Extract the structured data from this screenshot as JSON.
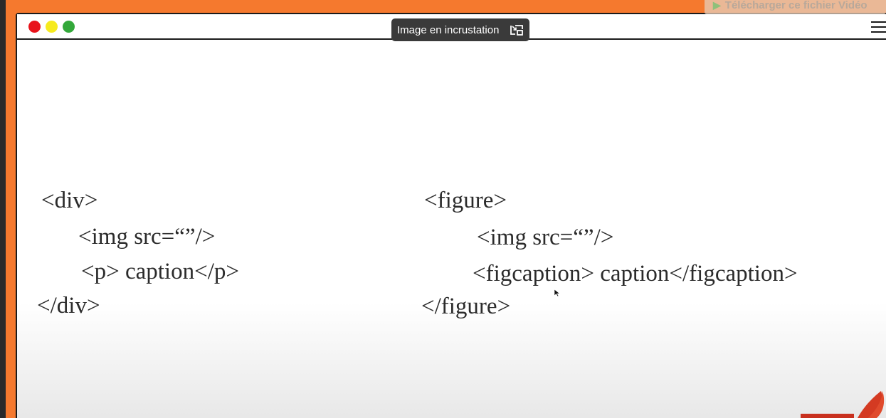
{
  "download_button": {
    "label": "Télécharger ce fichier Vidéo"
  },
  "pip_tooltip": {
    "label": "Image en incrustation"
  },
  "left_code": [
    "<div>",
    "<img src=“”/>",
    "<p> caption</p>",
    "</div>"
  ],
  "right_code": [
    "<figure>",
    "<img src=“”/>",
    "<figcaption> caption</figcaption>",
    "</figure>"
  ],
  "colors": {
    "frame": "#f5792e",
    "close": "#e8131b",
    "minimize": "#f6ea1e",
    "maximize": "#33a83a"
  },
  "icons": [
    "menu-icon",
    "picture-in-picture-icon",
    "play-icon",
    "mouse-cursor-icon"
  ]
}
